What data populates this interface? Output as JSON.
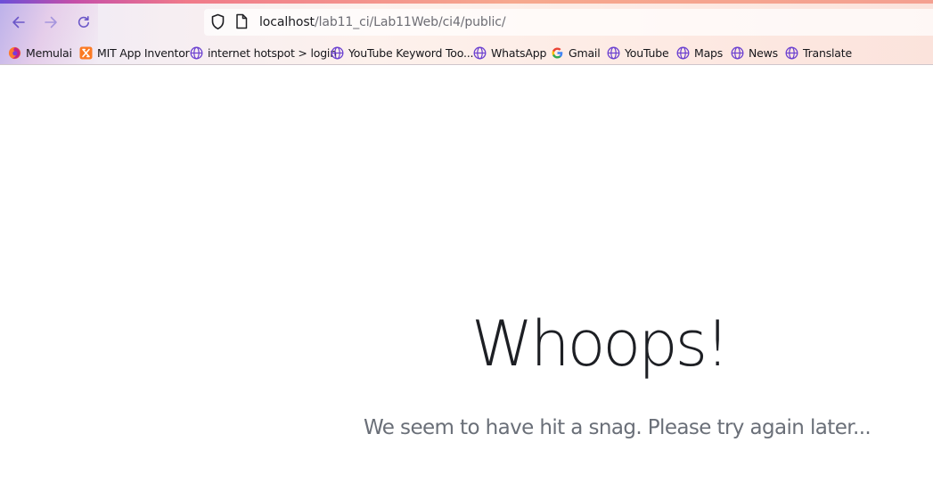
{
  "browser": {
    "url_host": "localhost",
    "url_path": "/lab11_ci/Lab11Web/ci4/public/",
    "colors": {
      "toolbar_gradient_start": "#ece8f6",
      "toolbar_gradient_end": "#fbe3dc",
      "accent": "#6b4fd8"
    }
  },
  "bookmarks": [
    {
      "label": "Memulai",
      "icon": "firefox-icon"
    },
    {
      "label": "MIT App Inventor",
      "icon": "xampp-icon"
    },
    {
      "label": "internet hotspot > login",
      "icon": "globe-icon"
    },
    {
      "label": "YouTube Keyword Too...",
      "icon": "globe-icon"
    },
    {
      "label": "WhatsApp",
      "icon": "globe-icon"
    },
    {
      "label": "Gmail",
      "icon": "google-icon"
    },
    {
      "label": "YouTube",
      "icon": "globe-icon"
    },
    {
      "label": "Maps",
      "icon": "globe-icon"
    },
    {
      "label": "News",
      "icon": "globe-icon"
    },
    {
      "label": "Translate",
      "icon": "globe-icon"
    }
  ],
  "page": {
    "title": "Whoops!",
    "message": "We seem to have hit a snag. Please try again later..."
  }
}
